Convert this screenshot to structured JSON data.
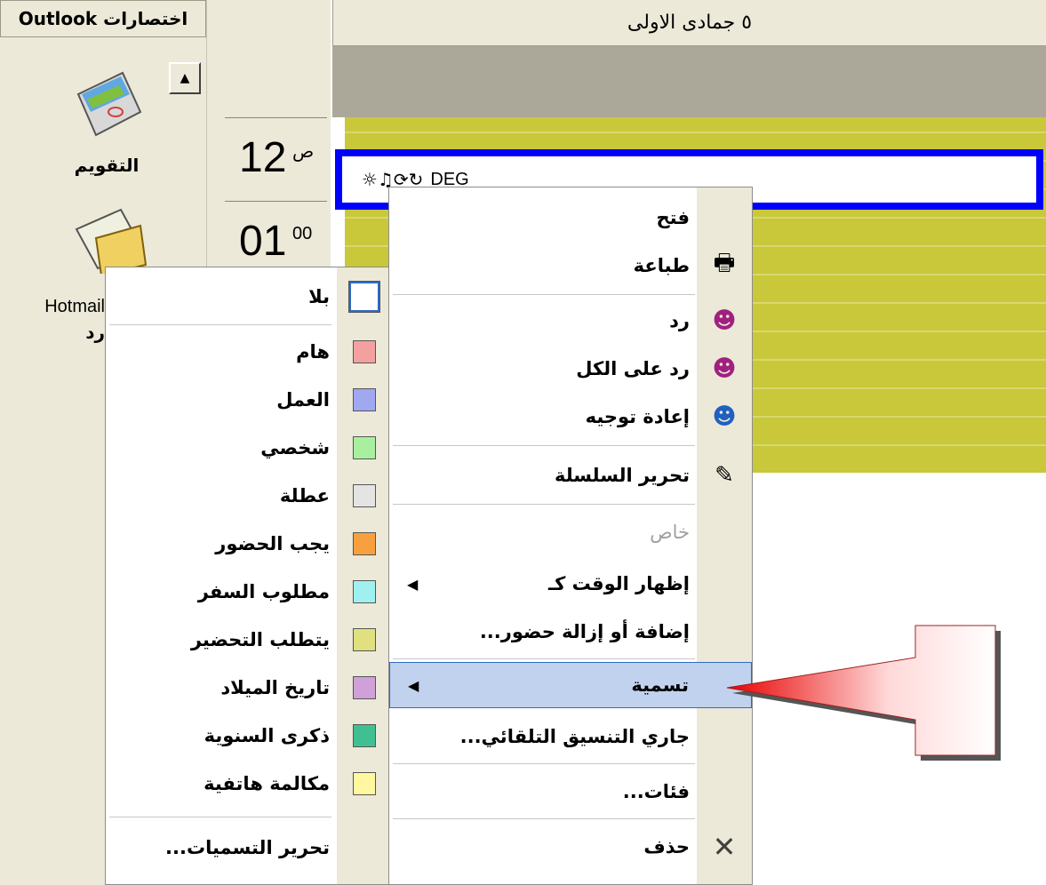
{
  "shortcuts": {
    "header": "اختصارات Outlook",
    "calendar_label": "التقويم",
    "hotmail_label_1": "Hotmail",
    "hotmail_label_2": "رد"
  },
  "time": {
    "slot1_hour": "12",
    "slot1_sup": "ص",
    "slot2_hour": "01",
    "slot2_sup": "00"
  },
  "calendar": {
    "date_header": "٥ جمادى الاولى",
    "appointment_title": "DEG"
  },
  "context_menu": {
    "items": [
      {
        "label": "فتح",
        "icon": ""
      },
      {
        "label": "طباعة",
        "icon": "printer-icon"
      },
      {
        "label": "رد",
        "icon": "reply-icon"
      },
      {
        "label": "رد على الكل",
        "icon": "reply-all-icon"
      },
      {
        "label": "إعادة توجيه",
        "icon": "forward-icon"
      },
      {
        "label": "تحرير السلسلة",
        "icon": "edit-series-icon"
      },
      {
        "label": "خاص",
        "icon": ""
      },
      {
        "label": "إظهار الوقت كـ",
        "icon": ""
      },
      {
        "label": "إضافة أو إزالة حضور...",
        "icon": ""
      },
      {
        "label": "تسمية",
        "icon": ""
      },
      {
        "label": "جاري التنسيق التلقائي...",
        "icon": ""
      },
      {
        "label": "فئات...",
        "icon": ""
      },
      {
        "label": "حذف",
        "icon": "delete-icon"
      }
    ]
  },
  "label_menu": {
    "items": [
      {
        "label": "بلا",
        "color": "#ffffff"
      },
      {
        "label": "هام",
        "color": "#f4a0a0"
      },
      {
        "label": "العمل",
        "color": "#a0a8f0"
      },
      {
        "label": "شخصي",
        "color": "#a8f0a0"
      },
      {
        "label": "عطلة",
        "color": "#e4e4e4"
      },
      {
        "label": "يجب الحضور",
        "color": "#f8a040"
      },
      {
        "label": "مطلوب السفر",
        "color": "#a0f0f0"
      },
      {
        "label": "يتطلب التحضير",
        "color": "#e0e080"
      },
      {
        "label": "تاريخ الميلاد",
        "color": "#d0a0d8"
      },
      {
        "label": "ذكرى السنوية",
        "color": "#40c090"
      },
      {
        "label": "مكالمة هاتفية",
        "color": "#fff8a0"
      },
      {
        "label": "تحرير التسميات...",
        "color": ""
      }
    ]
  }
}
